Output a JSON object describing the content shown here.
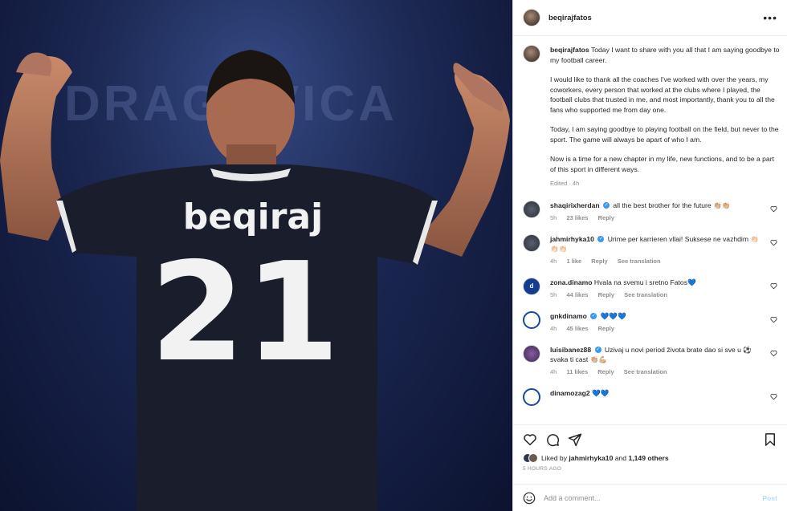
{
  "post": {
    "username": "beqirajfatos",
    "photo": {
      "jersey_name": "beqiraj",
      "jersey_number": "21",
      "stadium_text": "DRAGOVICA"
    },
    "caption": {
      "p1": "Today I want to share with you all that I am saying goodbye to my football career.",
      "p2": "I would like to thank all the coaches I've worked with over the years, my coworkers, every person that worked at the clubs where I played, the football clubs that trusted in me, and most importantly, thank you to all the fans who supported me from day one.",
      "p3": "Today, I am saying goodbye to playing football on the field, but never to the sport. The game will always be apart of who I am.",
      "p4": "Now is a time for a new chapter in my life, new functions, and to be a part of this sport in different ways.",
      "meta": "Edited · 4h"
    }
  },
  "comments": [
    {
      "user": "shaqirixherdan",
      "verified": true,
      "text": "all the best brother for the future 👏🏼👏🏼",
      "time": "5h",
      "likes": "23 likes",
      "reply": "Reply",
      "translate": ""
    },
    {
      "user": "jahmirhyka10",
      "verified": true,
      "text": "Urime per karrieren vllai! Suksese ne vazhdim 👏🏻👏🏻👏🏻",
      "time": "4h",
      "likes": "1 like",
      "reply": "Reply",
      "translate": "See translation"
    },
    {
      "user": "zona.dinamo",
      "verified": false,
      "text": "Hvala na svemu i sretno Fatos💙",
      "time": "5h",
      "likes": "44 likes",
      "reply": "Reply",
      "translate": "See translation"
    },
    {
      "user": "gnkdinamo",
      "verified": true,
      "text": "💙💙💙",
      "time": "4h",
      "likes": "45 likes",
      "reply": "Reply",
      "translate": ""
    },
    {
      "user": "luisibanez88",
      "verified": true,
      "text": "Uzivaj u novi period života brate dao si sve u ⚽ svaka ti cast 👏🏼💪🏼",
      "time": "4h",
      "likes": "11 likes",
      "reply": "Reply",
      "translate": "See translation"
    },
    {
      "user": "dinamozag2",
      "verified": false,
      "text": "💙💙",
      "time": "",
      "likes": "",
      "reply": "",
      "translate": ""
    }
  ],
  "likes": {
    "prefix": "Liked by",
    "user": "jahmirhyka10",
    "and": "and",
    "others": "1,149 others"
  },
  "time_ago": "5 HOURS AGO",
  "add_comment": {
    "placeholder": "Add a comment...",
    "post_label": "Post"
  },
  "colors": {
    "accent": "#0095f6",
    "verified": "#3897f0",
    "muted": "#8e8e8e"
  }
}
